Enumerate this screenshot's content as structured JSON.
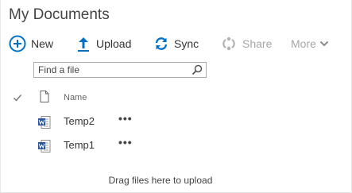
{
  "page": {
    "title": "My Documents"
  },
  "command_bar": {
    "new_label": "New",
    "upload_label": "Upload",
    "sync_label": "Sync",
    "share_label": "Share",
    "more_label": "More",
    "accent_color": "#0072c6",
    "disabled_color": "#a6a6a6"
  },
  "search": {
    "placeholder": "Find a file",
    "value": ""
  },
  "list": {
    "header": {
      "name_label": "Name"
    },
    "rows": [
      {
        "name": "Temp2",
        "icon": "word-document-icon",
        "menu": "•••"
      },
      {
        "name": "Temp1",
        "icon": "word-document-icon",
        "menu": "•••"
      }
    ],
    "word_icon_color": "#2b579a"
  },
  "footer": {
    "drop_hint": "Drag files here to upload"
  }
}
